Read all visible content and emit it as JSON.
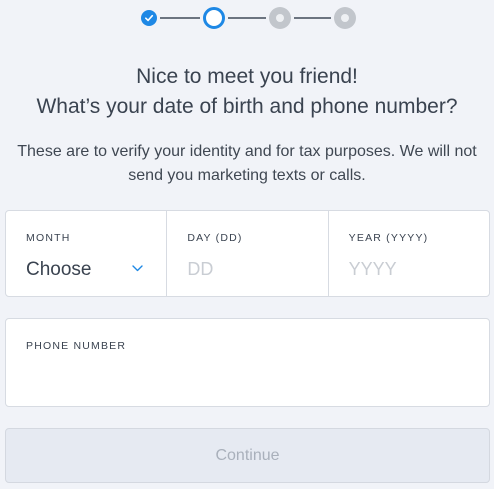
{
  "stepper": {
    "total_steps": 4,
    "current_step": 2,
    "completed_steps": 1
  },
  "heading": {
    "line1": "Nice to meet you friend!",
    "line2": "What’s your date of birth and phone number?"
  },
  "subtitle": "These are to verify your identity and for tax purposes. We will not send you marketing texts or calls.",
  "dob": {
    "month": {
      "label": "MONTH",
      "value": "Choose"
    },
    "day": {
      "label": "DAY (DD)",
      "placeholder": "DD"
    },
    "year": {
      "label": "YEAR (YYYY)",
      "placeholder": "YYYY"
    }
  },
  "phone": {
    "label": "PHONE NUMBER",
    "placeholder": ""
  },
  "continue_label": "Continue",
  "colors": {
    "accent": "#1e88e5",
    "pending": "#c2c6cc",
    "background": "#f1f3f8",
    "disabled_text": "#a9b0bb"
  }
}
